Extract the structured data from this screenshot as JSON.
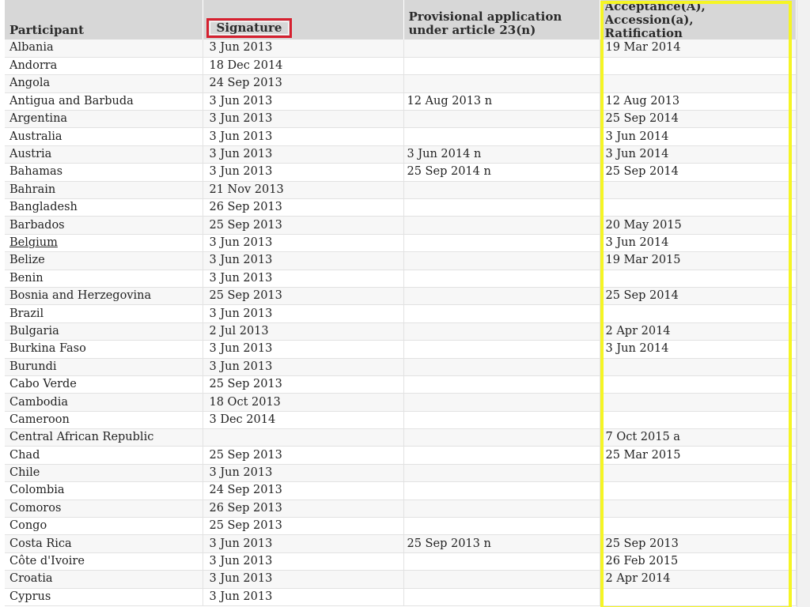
{
  "table": {
    "headers": {
      "participant": "Participant",
      "signature": "Signature",
      "provisional": [
        "Provisional application",
        "under article 23(n)"
      ],
      "ratification": [
        "Acceptance(A),",
        "Accession(a),",
        "Ratification"
      ]
    },
    "rows": [
      {
        "participant": "Albania",
        "signature": "3 Jun 2013",
        "provisional": "",
        "ratification": "19 Mar 2014"
      },
      {
        "participant": "Andorra",
        "signature": "18 Dec 2014",
        "provisional": "",
        "ratification": ""
      },
      {
        "participant": "Angola",
        "signature": "24 Sep 2013",
        "provisional": "",
        "ratification": ""
      },
      {
        "participant": "Antigua and Barbuda",
        "signature": "3 Jun 2013",
        "provisional": "12 Aug 2013 n",
        "ratification": "12 Aug 2013"
      },
      {
        "participant": "Argentina",
        "signature": "3 Jun 2013",
        "provisional": "",
        "ratification": "25 Sep 2014"
      },
      {
        "participant": "Australia",
        "signature": "3 Jun 2013",
        "provisional": "",
        "ratification": "3 Jun 2014"
      },
      {
        "participant": "Austria",
        "signature": "3 Jun 2013",
        "provisional": "3 Jun 2014 n",
        "ratification": "3 Jun 2014"
      },
      {
        "participant": "Bahamas",
        "signature": "3 Jun 2013",
        "provisional": "25 Sep 2014 n",
        "ratification": "25 Sep 2014"
      },
      {
        "participant": "Bahrain",
        "signature": "21 Nov 2013",
        "provisional": "",
        "ratification": ""
      },
      {
        "participant": "Bangladesh",
        "signature": "26 Sep 2013",
        "provisional": "",
        "ratification": ""
      },
      {
        "participant": "Barbados",
        "signature": "25 Sep 2013",
        "provisional": "",
        "ratification": "20 May 2015"
      },
      {
        "participant": "Belgium",
        "signature": "3 Jun 2013",
        "provisional": "",
        "ratification": "3 Jun 2014",
        "link": true
      },
      {
        "participant": "Belize",
        "signature": "3 Jun 2013",
        "provisional": "",
        "ratification": "19 Mar 2015"
      },
      {
        "participant": "Benin",
        "signature": "3 Jun 2013",
        "provisional": "",
        "ratification": ""
      },
      {
        "participant": "Bosnia and Herzegovina",
        "signature": "25 Sep 2013",
        "provisional": "",
        "ratification": "25 Sep 2014"
      },
      {
        "participant": "Brazil",
        "signature": "3 Jun 2013",
        "provisional": "",
        "ratification": ""
      },
      {
        "participant": "Bulgaria",
        "signature": "2 Jul 2013",
        "provisional": "",
        "ratification": "2 Apr 2014"
      },
      {
        "participant": "Burkina Faso",
        "signature": "3 Jun 2013",
        "provisional": "",
        "ratification": "3 Jun 2014"
      },
      {
        "participant": "Burundi",
        "signature": "3 Jun 2013",
        "provisional": "",
        "ratification": ""
      },
      {
        "participant": "Cabo Verde",
        "signature": "25 Sep 2013",
        "provisional": "",
        "ratification": ""
      },
      {
        "participant": "Cambodia",
        "signature": "18 Oct 2013",
        "provisional": "",
        "ratification": ""
      },
      {
        "participant": "Cameroon",
        "signature": "3 Dec 2014",
        "provisional": "",
        "ratification": ""
      },
      {
        "participant": "Central African Republic",
        "signature": "",
        "provisional": "",
        "ratification": "7 Oct 2015 a"
      },
      {
        "participant": "Chad",
        "signature": "25 Sep 2013",
        "provisional": "",
        "ratification": "25 Mar 2015"
      },
      {
        "participant": "Chile",
        "signature": "3 Jun 2013",
        "provisional": "",
        "ratification": ""
      },
      {
        "participant": "Colombia",
        "signature": "24 Sep 2013",
        "provisional": "",
        "ratification": ""
      },
      {
        "participant": "Comoros",
        "signature": "26 Sep 2013",
        "provisional": "",
        "ratification": ""
      },
      {
        "participant": "Congo",
        "signature": "25 Sep 2013",
        "provisional": "",
        "ratification": ""
      },
      {
        "participant": "Costa Rica",
        "signature": "3 Jun 2013",
        "provisional": "25 Sep 2013 n",
        "ratification": "25 Sep 2013"
      },
      {
        "participant": "Côte d'Ivoire",
        "signature": "3 Jun 2013",
        "provisional": "",
        "ratification": "26 Feb 2015"
      },
      {
        "participant": "Croatia",
        "signature": "3 Jun 2013",
        "provisional": "",
        "ratification": "2 Apr 2014"
      },
      {
        "participant": "Cyprus",
        "signature": "3 Jun 2013",
        "provisional": "",
        "ratification": ""
      }
    ]
  },
  "highlight": {
    "signature_border_color": "#d6202f",
    "ratification_border_color": "#f5f524"
  }
}
